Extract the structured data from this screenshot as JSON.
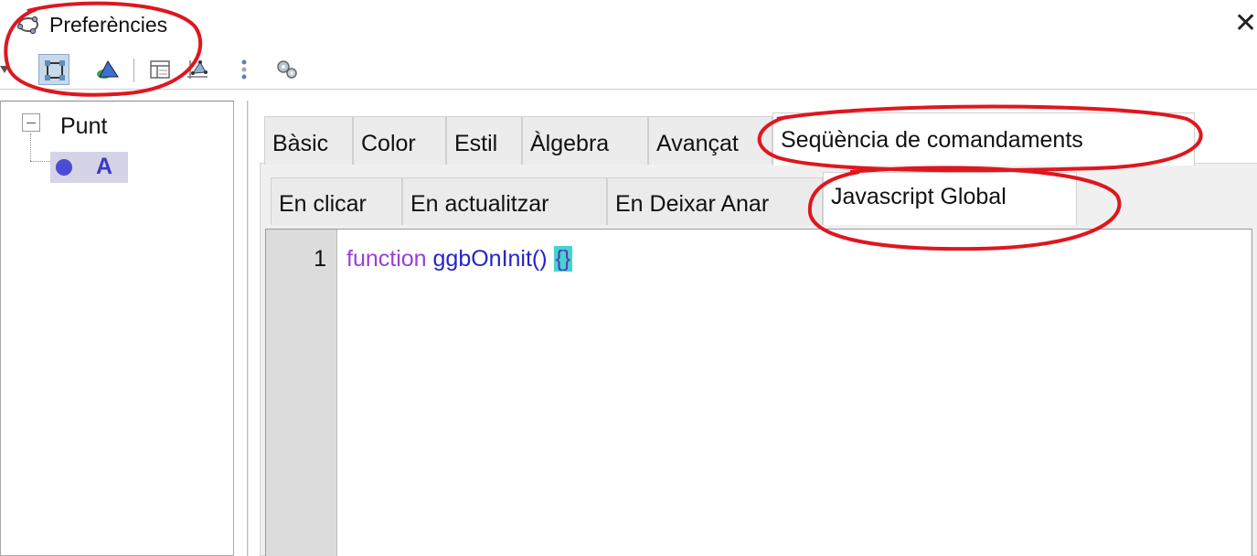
{
  "window": {
    "title": "Preferències",
    "close_label": "✕"
  },
  "toolbar": {
    "tools": [
      {
        "icon": "point-style-icon",
        "selected": true
      },
      {
        "icon": "geometric-object-icon",
        "selected": false
      },
      {
        "icon": "graphics-view-icon",
        "selected": false
      },
      {
        "icon": "algebra-view-icon",
        "selected": false
      },
      {
        "icon": "more-options-icon",
        "selected": false
      },
      {
        "icon": "advanced-settings-icon",
        "selected": false
      }
    ]
  },
  "tree": {
    "root_label": "Punt",
    "child_label": "A",
    "child_color": "#4b4bd6"
  },
  "tabs": [
    {
      "label": "Bàsic",
      "active": false
    },
    {
      "label": "Color",
      "active": false
    },
    {
      "label": "Estil",
      "active": false
    },
    {
      "label": "Àlgebra",
      "active": false
    },
    {
      "label": "Avançat",
      "active": false
    },
    {
      "label": "Seqüència de comandaments",
      "active": true
    }
  ],
  "subtabs": [
    {
      "label": "En clicar",
      "active": false
    },
    {
      "label": "En actualitzar",
      "active": false
    },
    {
      "label": "En Deixar Anar",
      "active": false
    },
    {
      "label": "Javascript Global",
      "active": true
    }
  ],
  "editor": {
    "line_number": "1",
    "keyword": "function",
    "function_name": "ggbOnInit()",
    "braces": "{}"
  },
  "colors": {
    "annotation": "#e0161e",
    "keyword": "#9a3fd4",
    "function_name": "#2424cc",
    "bracket_highlight": "#40d6cf"
  }
}
